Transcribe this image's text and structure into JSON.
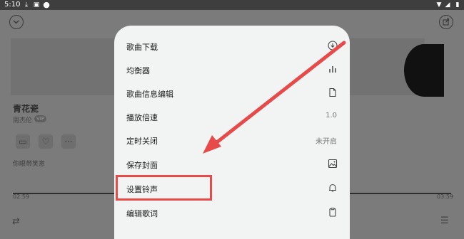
{
  "status_bar": {
    "time": "5:10",
    "icons": [
      "download-icon",
      "notification-icon",
      "circle-icon",
      "wifi-icon",
      "signal-icon",
      "battery-icon"
    ]
  },
  "player": {
    "song_title": "青花瓷",
    "artist": "周杰伦",
    "artist_badge": "VIP",
    "comment_placeholder": "你眼带笑意",
    "elapsed": "02:59",
    "duration": "03:59",
    "progress_fraction": 1.0,
    "icons": [
      "collapse-icon",
      "share-icon",
      "comment-icon",
      "like-icon",
      "more-icon",
      "repeat-icon",
      "playlist-icon"
    ]
  },
  "menu": {
    "items": [
      {
        "label": "歌曲下载",
        "icon": "download-icon"
      },
      {
        "label": "均衡器",
        "icon": "equalizer-icon"
      },
      {
        "label": "歌曲信息编辑",
        "icon": "file-icon"
      },
      {
        "label": "播放倍速",
        "value": "1.0"
      },
      {
        "label": "定时关闭",
        "value": "未开启"
      },
      {
        "label": "保存封面",
        "icon": "image-icon"
      },
      {
        "label": "设置铃声",
        "icon": "bell-icon"
      },
      {
        "label": "编辑歌词",
        "icon": "clipboard-icon"
      }
    ],
    "highlighted_item": "设置铃声"
  },
  "colors": {
    "annotation": "#e84a4a",
    "sheet_bg": "#f2f4f3",
    "overlay": "#7a7a7a"
  }
}
